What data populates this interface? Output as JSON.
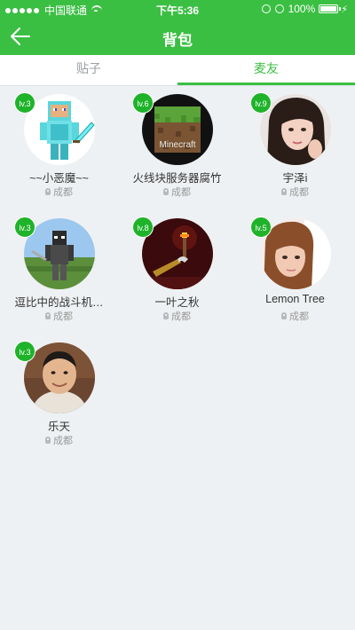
{
  "status": {
    "carrier": "中国联通",
    "time": "下午5:36",
    "battery": "100%"
  },
  "nav": {
    "title": "背包"
  },
  "tabs": [
    {
      "label": "贴子"
    },
    {
      "label": "麦友"
    }
  ],
  "friends": [
    {
      "name": "~~小恶魔~~",
      "level": "lv.3",
      "location": "成都"
    },
    {
      "name": "火线块服务器腐竹",
      "level": "lv.6",
      "location": "成都",
      "avatar_text": "Minecraft"
    },
    {
      "name": "宇泽i",
      "level": "lv.9",
      "location": "成都"
    },
    {
      "name": "逗比中的战斗机…",
      "level": "lv.3",
      "location": "成都"
    },
    {
      "name": "一叶之秋",
      "level": "lv.8",
      "location": "成都"
    },
    {
      "name": "Lemon Tree",
      "level": "lv.5",
      "location": "成都"
    },
    {
      "name": "乐天",
      "level": "lv.3",
      "location": "成都"
    }
  ],
  "colors": {
    "accent": "#3bbf43",
    "badge": "#1fb32a",
    "background": "#eef1f3"
  }
}
